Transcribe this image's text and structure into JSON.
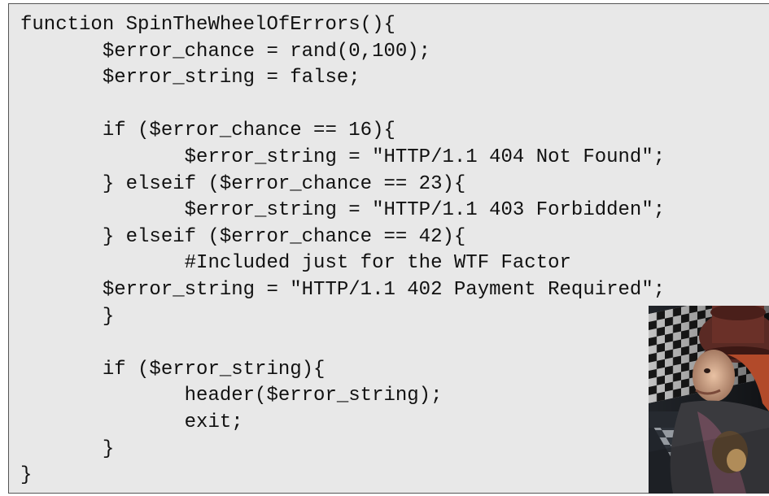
{
  "code": {
    "lines": [
      "function SpinTheWheelOfErrors(){",
      "       $error_chance = rand(0,100);",
      "       $error_string = false;",
      "",
      "       if ($error_chance == 16){",
      "              $error_string = \"HTTP/1.1 404 Not Found\";",
      "       } elseif ($error_chance == 23){",
      "              $error_string = \"HTTP/1.1 403 Forbidden\";",
      "       } elseif ($error_chance == 42){",
      "              #Included just for the WTF Factor",
      "       $error_string = \"HTTP/1.1 402 Payment Required\";",
      "       }",
      "",
      "       if ($error_string){",
      "              header($error_string);",
      "              exit;",
      "       }",
      "}"
    ]
  },
  "colors": {
    "panel_background": "#e8e8e8",
    "panel_border": "#555555",
    "text": "#111111"
  }
}
